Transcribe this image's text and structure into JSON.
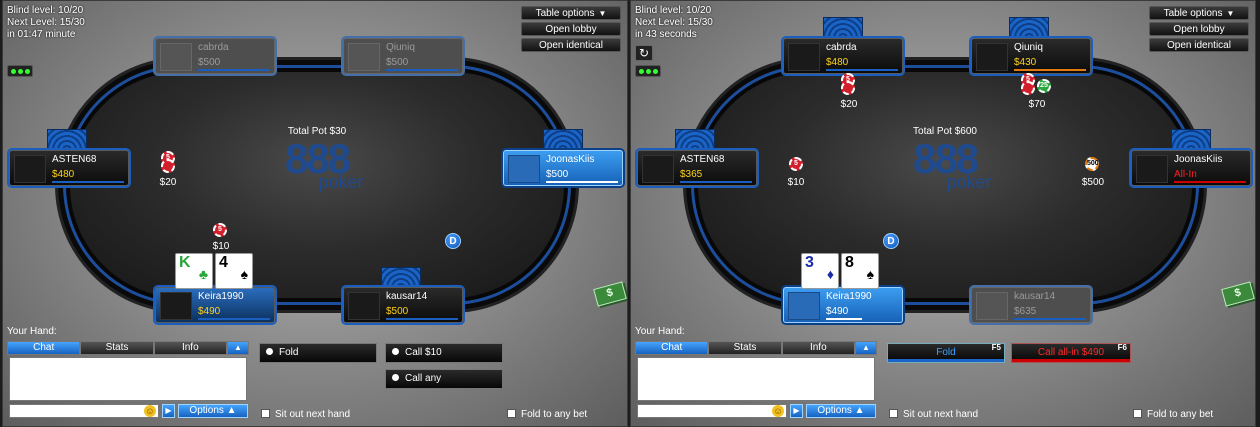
{
  "colors": {
    "accent": "#1a64c8",
    "stack": "#ffd21a",
    "allin": "#ff2020",
    "felt": "#2c2c2c"
  },
  "buttons": {
    "table_options": "Table options",
    "open_lobby": "Open lobby",
    "open_identical": "Open identical"
  },
  "bottom": {
    "your_hand": "Your Hand:",
    "tabs": [
      "Chat",
      "Stats",
      "Info"
    ],
    "options": "Options",
    "sit_out": "Sit out next hand",
    "fold_any": "Fold to any bet"
  },
  "left": {
    "blind_level": "Blind level: 10/20",
    "next_level": "Next Level: 15/30",
    "time_left": "in 01:47 minute",
    "pot": "Total Pot $30",
    "logo": "888",
    "logo_sub": "poker",
    "seats": {
      "cabrda": {
        "name": "cabrda",
        "stack": "$500"
      },
      "qiuniq": {
        "name": "Qiuniq",
        "stack": "$500"
      },
      "asten": {
        "name": "ASTEN68",
        "stack": "$480"
      },
      "joonas": {
        "name": "JoonasKiis",
        "stack": "$500"
      },
      "keira": {
        "name": "Keira1990",
        "stack": "$490"
      },
      "kausar": {
        "name": "kausar14",
        "stack": "$500"
      }
    },
    "bets": {
      "asten": "$20",
      "keira": "$10"
    },
    "chips": {
      "asten": "5",
      "keira": "5"
    },
    "dealer": "D",
    "hole_cards": [
      {
        "rank": "K",
        "suit": "♣",
        "color": "#2aa63c"
      },
      {
        "rank": "4",
        "suit": "♠",
        "color": "#000000"
      }
    ],
    "actions": {
      "fold": "Fold",
      "call": "Call $10",
      "call_any": "Call any"
    }
  },
  "right": {
    "blind_level": "Blind level: 10/20",
    "next_level": "Next Level: 15/30",
    "time_left": "in 43 seconds",
    "pot": "Total Pot $600",
    "logo": "888",
    "logo_sub": "poker",
    "seats": {
      "cabrda": {
        "name": "cabrda",
        "stack": "$480"
      },
      "qiuniq": {
        "name": "Qiuniq",
        "stack": "$430"
      },
      "asten": {
        "name": "ASTEN68",
        "stack": "$365"
      },
      "joonas": {
        "name": "JoonasKiis",
        "stack": "All-In"
      },
      "keira": {
        "name": "Keira1990",
        "stack": "$490"
      },
      "kausar": {
        "name": "kausar14",
        "stack": "$635"
      }
    },
    "bets": {
      "cabrda": "$20",
      "qiuniq": "$70",
      "asten": "$10",
      "joonas": "$500"
    },
    "chips": {
      "cabrda": "5",
      "qiuniq_a": "5",
      "qiuniq_b": "25",
      "asten": "5",
      "joonas": "500"
    },
    "dealer": "D",
    "hole_cards": [
      {
        "rank": "3",
        "suit": "♦",
        "color": "#1a2aa8"
      },
      {
        "rank": "8",
        "suit": "♠",
        "color": "#000000"
      }
    ],
    "actions": {
      "fold": "Fold",
      "fold_key": "F5",
      "call_allin": "Call all-in $490",
      "call_key": "F6"
    }
  }
}
